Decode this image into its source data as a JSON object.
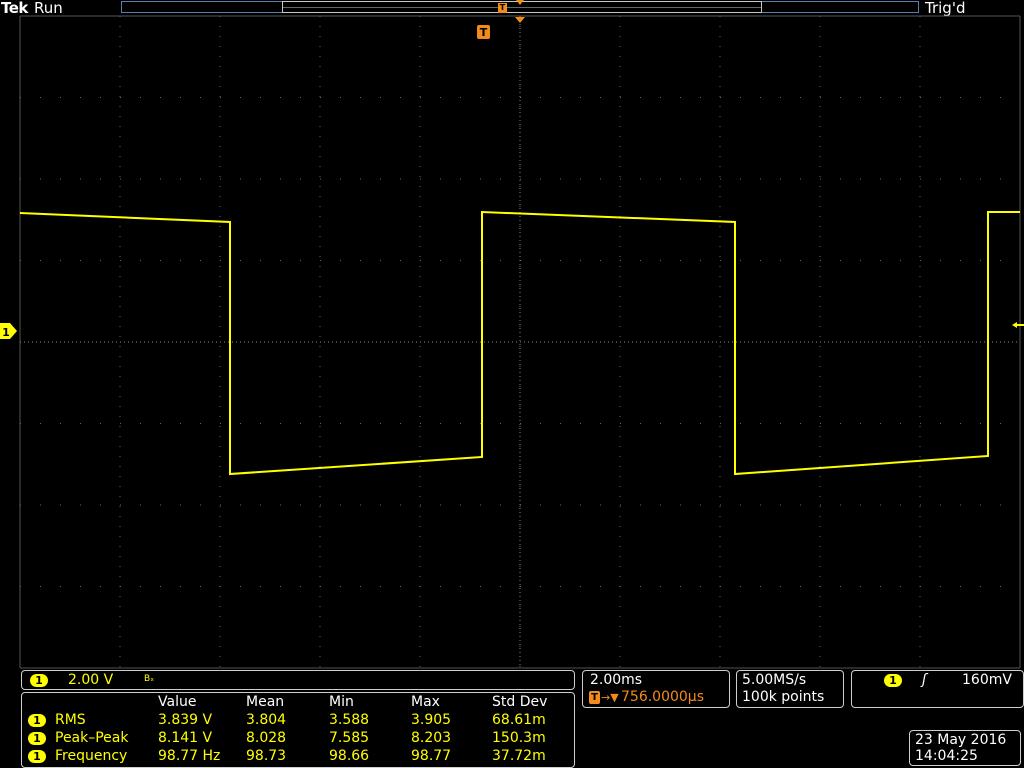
{
  "header": {
    "logo": "Tek",
    "run_state": "Run",
    "trigger_state": "Trig'd"
  },
  "channel": {
    "number": "1",
    "scale": "2.00 V",
    "bandwidth_flag": "Bₓ",
    "color": "#ffff00"
  },
  "timebase": {
    "scale": "2.00ms",
    "trigger_icon": "T",
    "trigger_arrow": "→▼",
    "delay": "756.0000µs"
  },
  "acquisition": {
    "sample_rate": "5.00MS/s",
    "record_length": "100k points"
  },
  "trigger": {
    "source": "1",
    "slope_icon": "rising-edge-icon",
    "slope_glyph": "ʃ",
    "level": "160mV"
  },
  "measurements": {
    "headers": [
      "Value",
      "Mean",
      "Min",
      "Max",
      "Std Dev"
    ],
    "rows": [
      {
        "channel": "1",
        "name": "RMS",
        "value": "3.839 V",
        "mean": "3.804",
        "min": "3.588",
        "max": "3.905",
        "std": "68.61m"
      },
      {
        "channel": "1",
        "name": "Peak–Peak",
        "value": "8.141 V",
        "mean": "8.028",
        "min": "7.585",
        "max": "8.203",
        "std": "150.3m"
      },
      {
        "channel": "1",
        "name": "Frequency",
        "value": "98.77 Hz",
        "mean": "98.73",
        "min": "98.66",
        "max": "98.77",
        "std": "37.72m"
      }
    ]
  },
  "datetime": {
    "date": "23 May 2016",
    "time": "14:04:25"
  },
  "waveform": {
    "color": "#ffff00",
    "ground_marker": "1",
    "trigger_marker": "T"
  }
}
